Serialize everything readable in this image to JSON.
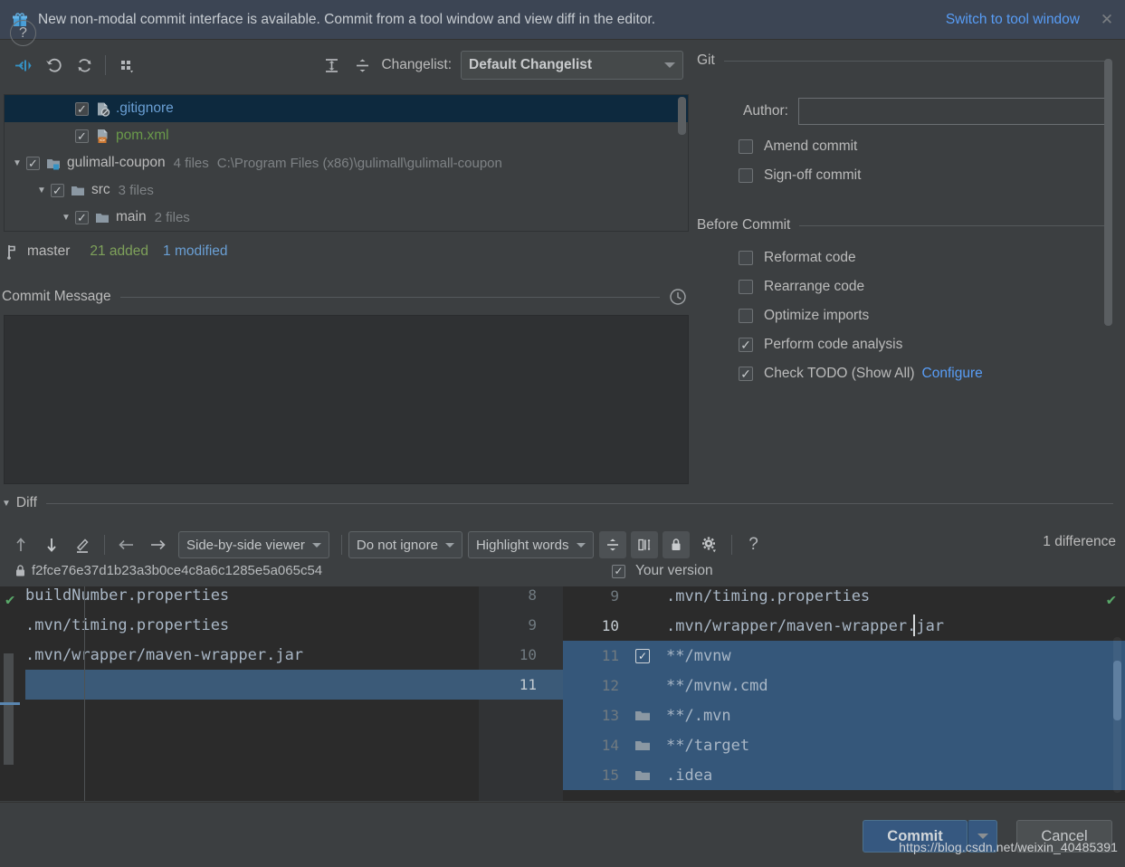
{
  "banner": {
    "icon": "gift-icon",
    "message": "New non-modal commit interface is available. Commit from a tool window and view diff in the editor.",
    "action_link": "Switch to tool window",
    "close": "✕",
    "bg_color": "#3c4554",
    "link_color": "#589df6"
  },
  "toolbar": {
    "icons": [
      {
        "name": "collapse-to-selection-icon",
        "tooltip": "Show Diff"
      },
      {
        "name": "rollback-icon",
        "tooltip": "Revert"
      },
      {
        "name": "refresh-icon",
        "tooltip": "Refresh"
      },
      {
        "name": "group-by-icon",
        "tooltip": "Group By"
      },
      {
        "name": "expand-all-icon",
        "tooltip": "Expand All"
      },
      {
        "name": "collapse-all-icon",
        "tooltip": "Collapse All"
      }
    ],
    "changelist_label": "Changelist:",
    "changelist_value": "Default Changelist"
  },
  "file_tree": [
    {
      "indent": 2,
      "twisty": "",
      "checked": true,
      "icon": "gitignore-file-icon",
      "name": ".gitignore",
      "name_color": "blue",
      "meta": "",
      "path": "",
      "selected": true
    },
    {
      "indent": 2,
      "twisty": "",
      "checked": true,
      "icon": "xml-file-icon",
      "name": "pom.xml",
      "name_color": "green",
      "meta": "",
      "path": "",
      "selected": false
    },
    {
      "indent": 0,
      "twisty": "▼",
      "checked": true,
      "icon": "module-folder-icon",
      "name": "gulimall-coupon",
      "name_color": "plain",
      "meta": "4 files",
      "path": "C:\\Program Files (x86)\\gulimall\\gulimall-coupon",
      "selected": false
    },
    {
      "indent": 1,
      "twisty": "▼",
      "checked": true,
      "icon": "folder-icon",
      "name": "src",
      "name_color": "plain",
      "meta": "3 files",
      "path": "",
      "selected": false
    },
    {
      "indent": 2,
      "twisty": "▼",
      "checked": true,
      "icon": "folder-icon",
      "name": "main",
      "name_color": "plain",
      "meta": "2 files",
      "path": "",
      "selected": false
    }
  ],
  "status": {
    "branch_icon": "branch-icon",
    "branch": "master",
    "added": "21 added",
    "modified": "1 modified",
    "added_color": "#7ea15a",
    "modified_color": "#6a9fd4"
  },
  "commit_message": {
    "title": "Commit Message",
    "history_icon": "clock-icon",
    "value": ""
  },
  "git_panel": {
    "group_title": "Git",
    "author_label": "Author:",
    "author_value": "",
    "author_placeholder": "",
    "options": [
      {
        "name": "amend-commit",
        "label": "Amend commit",
        "checked": false
      },
      {
        "name": "sign-off-commit",
        "label": "Sign-off commit",
        "checked": false
      }
    ]
  },
  "before_commit": {
    "group_title": "Before Commit",
    "options": [
      {
        "name": "reformat-code",
        "label": "Reformat code",
        "checked": false,
        "link": ""
      },
      {
        "name": "rearrange-code",
        "label": "Rearrange code",
        "checked": false,
        "link": ""
      },
      {
        "name": "optimize-imports",
        "label": "Optimize imports",
        "checked": false,
        "link": ""
      },
      {
        "name": "perform-code-analysis",
        "label": "Perform code analysis",
        "checked": true,
        "link": ""
      },
      {
        "name": "check-todo",
        "label": "Check TODO (Show All)",
        "checked": true,
        "link": "Configure"
      }
    ]
  },
  "diff": {
    "section_title": "Diff",
    "nav_icons": [
      {
        "name": "previous-difference-icon"
      },
      {
        "name": "next-difference-icon"
      },
      {
        "name": "annotate-icon"
      },
      {
        "name": "apply-left-icon"
      },
      {
        "name": "apply-right-icon"
      }
    ],
    "viewer_mode": "Side-by-side viewer",
    "whitespace_mode": "Do not ignore",
    "highlight_mode": "Highlight words",
    "toggle_icons": [
      {
        "name": "collapse-unchanged-icon",
        "active": true
      },
      {
        "name": "synchronize-scroll-icon",
        "active": true
      },
      {
        "name": "read-only-lock-icon",
        "active": true
      },
      {
        "name": "settings-gear-icon",
        "active": false
      },
      {
        "name": "help-question-icon",
        "active": false
      }
    ],
    "difference_count": "1 difference",
    "left_revision_icon": "lock-icon",
    "left_revision": "f2fce76e37d1b23a3b0ce4c8a6c1285e5a065c54",
    "right_label": "Your version",
    "right_checked": true,
    "left_lines": [
      {
        "num": "8",
        "text": "buildNumber.properties",
        "state": "partial"
      },
      {
        "num": "9",
        "text": ".mvn/timing.properties",
        "state": "normal"
      },
      {
        "num": "10",
        "text": ".mvn/wrapper/maven-wrapper.jar",
        "state": "normal"
      },
      {
        "num": "11",
        "text": "",
        "state": "inserted-empty"
      }
    ],
    "right_lines": [
      {
        "num": "9",
        "text": ".mvn/timing.properties",
        "state": "normal",
        "gutter": ""
      },
      {
        "num": "10",
        "text": ".mvn/wrapper/maven-wrapper.jar",
        "state": "normal",
        "gutter": "",
        "caret": true
      },
      {
        "num": "11",
        "text": "**/mvnw",
        "state": "added",
        "gutter": "checkbox-icon"
      },
      {
        "num": "12",
        "text": "**/mvnw.cmd",
        "state": "added",
        "gutter": ""
      },
      {
        "num": "13",
        "text": "**/.mvn",
        "state": "added",
        "gutter": "folder-icon"
      },
      {
        "num": "14",
        "text": "**/target",
        "state": "added",
        "gutter": "folder-icon"
      },
      {
        "num": "15",
        "text": ".idea",
        "state": "added",
        "gutter": "folder-icon"
      }
    ],
    "accept_left_icon": "accept-change-check-icon",
    "accept_right_icon": "accept-change-check-icon",
    "added_bg_color": "#35577a",
    "selected_bg_color": "#3b5a78"
  },
  "footer": {
    "help": "?",
    "commit_label": "Commit",
    "commit_dropdown": "▼",
    "cancel_label": "Cancel",
    "commit_color": "#365880"
  },
  "watermark": "https://blog.csdn.net/weixin_40485391"
}
